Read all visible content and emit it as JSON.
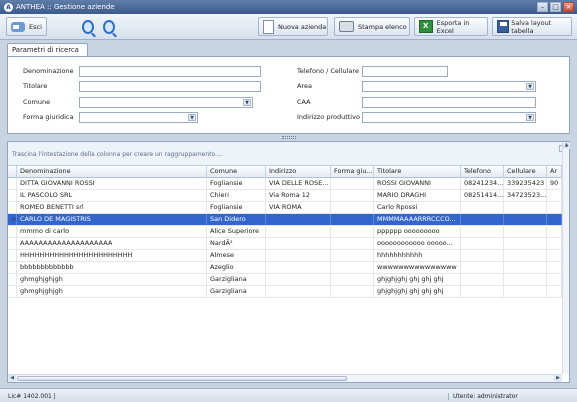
{
  "window": {
    "title": "ANTHEA :: Gestione aziende",
    "app_icon": "A"
  },
  "toolbar": {
    "exit_label": "Esci",
    "new_company_label": "Nuova azienda",
    "print_list_label": "Stampa elenco",
    "export_excel_label": "Esporta in Excel",
    "save_layout_label": "Salva layout tabella"
  },
  "search": {
    "tab_label": "Parametri di ricerca",
    "denominazione": {
      "label": "Denominazione",
      "value": ""
    },
    "titolare": {
      "label": "Titolare",
      "value": ""
    },
    "comune": {
      "label": "Comune",
      "value": ""
    },
    "forma_giuridica": {
      "label": "Forma giuridica",
      "value": ""
    },
    "telefono": {
      "label": "Telefono / Cellulare",
      "value": ""
    },
    "area": {
      "label": "Area",
      "value": ""
    },
    "caa": {
      "label": "CAA",
      "value": ""
    },
    "indirizzo_produttivo": {
      "label": "Indirizzo produttivo",
      "value": ""
    }
  },
  "grid": {
    "group_hint": "Trascina l'intestazione della colonna per creare un raggruppamento....",
    "columns": [
      "Denominazione",
      "Comune",
      "Indirizzo",
      "Forma giu...",
      "Titolare",
      "Telefono",
      "Cellulare",
      "Ar"
    ],
    "selected_indicator": ">",
    "rows": [
      [
        "DITTA GIOVANNI ROSSI",
        "Fogliansie",
        "VIA DELLE ROSE...",
        "",
        "ROSSI GIOVANNI",
        "08241234...",
        "339235423",
        "90"
      ],
      [
        "IL PASCOLO SRL",
        "Chieri",
        "Via Roma 12",
        "",
        "MARIO DRAGHI",
        "08251414...",
        "34723523...",
        ""
      ],
      [
        "ROMEO BENETTI srl",
        "Fogliansie",
        "VIA ROMA",
        "",
        "Carlo Rpossi",
        "",
        "",
        ""
      ],
      [
        "CARLO DE MAGISTRIS",
        "San Didero",
        "",
        "",
        "MMMMAAAARRRCCCO...",
        "",
        "",
        ""
      ],
      [
        "mmmo di carlo",
        "Alice Superiore",
        "",
        "",
        "pppppp ooooooooo",
        "",
        "",
        ""
      ],
      [
        "AAAAAAAAAAAAAAAAAAAA",
        "NardÃ²",
        "",
        "",
        "oooooooooooo ooooo...",
        "",
        "",
        ""
      ],
      [
        "HHHHHHHHHHHHHHHHHHHHHHH",
        "Almese",
        "",
        "",
        "hhhhhhhhhhh",
        "",
        "",
        ""
      ],
      [
        "bbbbbbbbbbbbb",
        "Azeglio",
        "",
        "",
        "wwwwwwwwwwwwwww",
        "",
        "",
        ""
      ],
      [
        "ghmghjghjgh",
        "Garzigliana",
        "",
        "",
        "ghjghjghj ghj ghj ghj",
        "",
        "",
        ""
      ],
      [
        "ghmghjghjgh",
        "Garzigliana",
        "",
        "",
        "ghjghjghj ghj ghj ghj",
        "",
        "",
        ""
      ]
    ],
    "selected_row": 3
  },
  "status": {
    "left": "Lic# 1402.001 |",
    "right": "Utente: administrator"
  },
  "colors": {
    "selection": "#3366cc",
    "titlebar": "#3c5b8c"
  }
}
